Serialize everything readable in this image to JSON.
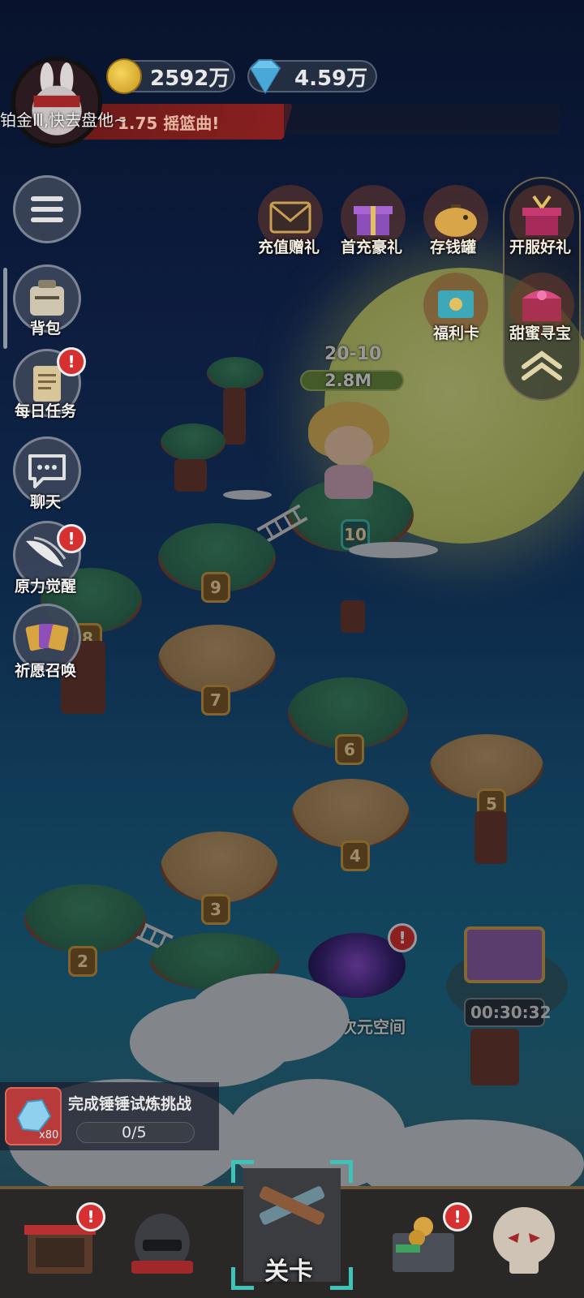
{
  "currency": {
    "gold": "2592万",
    "diamond": "4.59万"
  },
  "player": {
    "tease_text": "铂金Ⅲ,快去盘他~",
    "event_banner": "1.75  摇篮曲!"
  },
  "side_menu": [
    {
      "label": "背包",
      "icon": "backpack-icon",
      "badge": ""
    },
    {
      "label": "每日任务",
      "icon": "scroll-icon",
      "badge": "!"
    },
    {
      "label": "聊天",
      "icon": "chat-icon",
      "badge": ""
    },
    {
      "label": "原力觉醒",
      "icon": "wing-icon",
      "badge": "!"
    },
    {
      "label": "祈愿召唤",
      "icon": "cards-icon",
      "badge": ""
    }
  ],
  "top_events": [
    {
      "label": "充值赠礼",
      "icon": "envelope-icon"
    },
    {
      "label": "首充豪礼",
      "icon": "gift-icon"
    },
    {
      "label": "存钱罐",
      "icon": "piggy-bank-icon"
    },
    {
      "label": "开服好礼",
      "icon": "giftbox-icon"
    },
    {
      "label": "福利卡",
      "icon": "welfare-card-icon"
    },
    {
      "label": "甜蜜寻宝",
      "icon": "treasure-chest-icon"
    }
  ],
  "current_stage": {
    "level": "20-10",
    "power": "2.8M",
    "tile": "10"
  },
  "islands": [
    "2",
    "3",
    "4",
    "5",
    "6",
    "7",
    "8",
    "9"
  ],
  "special": {
    "hyperspace_label": "超次元空间",
    "chest_timer": "00:30:32"
  },
  "challenge": {
    "title": "完成锤锤试炼挑战",
    "progress": "0/5",
    "reward_count": "x80",
    "progress_value": 0
  },
  "bottom_nav": [
    {
      "label": "",
      "icon": "shop-icon",
      "badge": "!"
    },
    {
      "label": "",
      "icon": "knight-helmet-icon",
      "badge": ""
    },
    {
      "label": "关卡",
      "icon": "crossed-guns-icon",
      "badge": ""
    },
    {
      "label": "",
      "icon": "treasure-cart-icon",
      "badge": "!"
    },
    {
      "label": "",
      "icon": "skull-icon",
      "badge": ""
    }
  ]
}
